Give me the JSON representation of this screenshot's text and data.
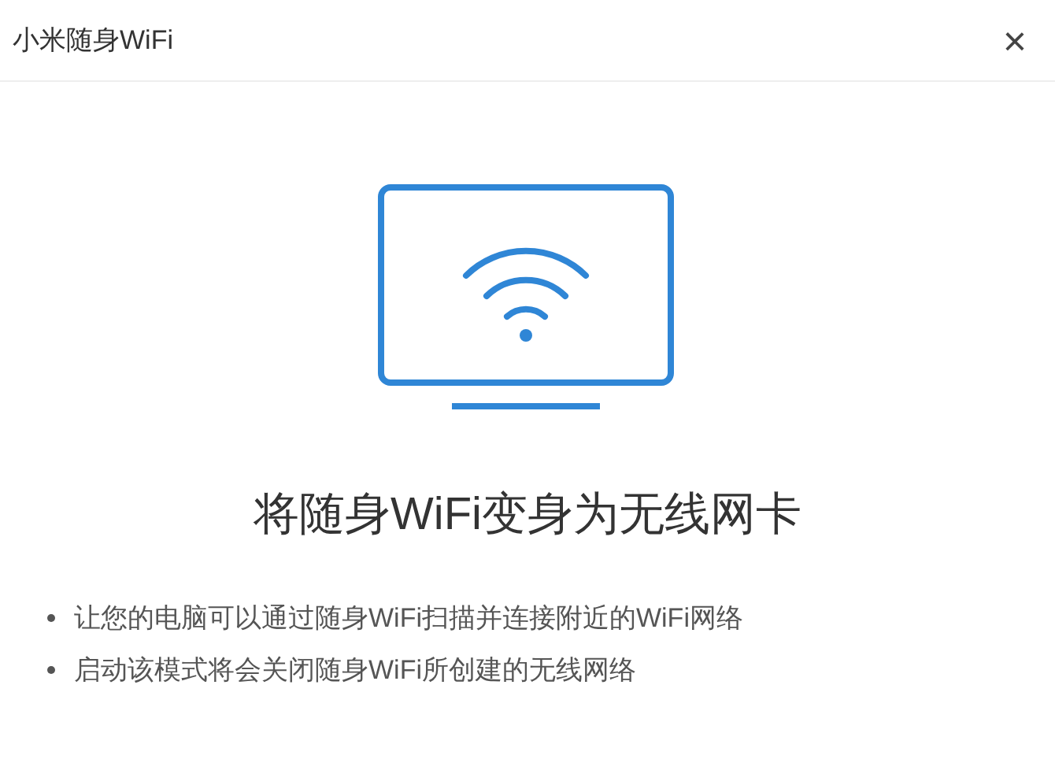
{
  "window": {
    "title": "小米随身WiFi",
    "close": "×"
  },
  "heading": "将随身WiFi变身为无线网卡",
  "bullets": [
    "让您的电脑可以通过随身WiFi扫描并连接附近的WiFi网络",
    "启动该模式将会关闭随身WiFi所创建的无线网络"
  ]
}
